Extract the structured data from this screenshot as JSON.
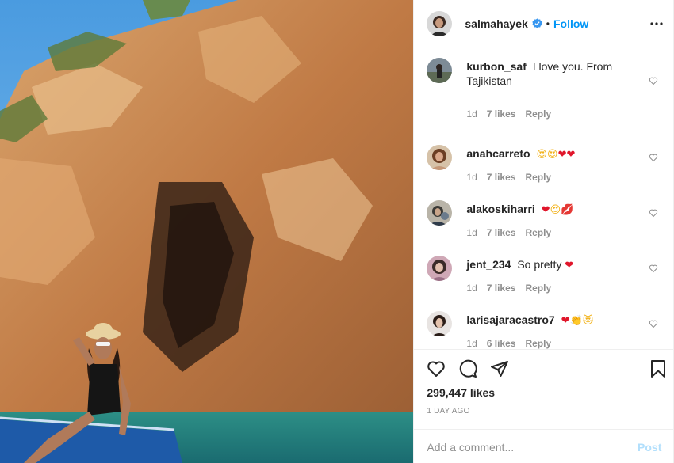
{
  "header": {
    "username": "salmahayek",
    "separator": "•",
    "follow_label": "Follow",
    "verified_icon": "verified-badge-icon",
    "more_icon": "more-options-icon"
  },
  "comments": [
    {
      "username": "kurbon_saf",
      "text": "I love you. From Tajikistan",
      "emoji": [],
      "time": "1d",
      "likes": "7 likes",
      "reply": "Reply"
    },
    {
      "username": "anahcarreto",
      "text": "",
      "emoji": [
        "😍",
        "😍",
        "❤",
        "❤"
      ],
      "time": "1d",
      "likes": "7 likes",
      "reply": "Reply"
    },
    {
      "username": "alakoskiharri",
      "text": "",
      "emoji": [
        "❤",
        "😍",
        "💋"
      ],
      "time": "1d",
      "likes": "7 likes",
      "reply": "Reply"
    },
    {
      "username": "jent_234",
      "text": "So pretty",
      "emoji": [
        "❤"
      ],
      "time": "1d",
      "likes": "7 likes",
      "reply": "Reply"
    },
    {
      "username": "larisajaracastro7",
      "text": "",
      "emoji": [
        "❤",
        "👏",
        "😻"
      ],
      "time": "1d",
      "likes": "6 likes",
      "reply": "Reply"
    }
  ],
  "actions": {
    "like_icon": "heart-icon",
    "comment_icon": "comment-icon",
    "share_icon": "share-icon",
    "save_icon": "bookmark-icon",
    "likes_count": "299,447 likes",
    "time_ago": "1 DAY AGO"
  },
  "composer": {
    "placeholder": "Add a comment...",
    "post_label": "Post"
  },
  "colors": {
    "link_blue": "#0095f6",
    "post_disabled": "#b2dffc",
    "meta_grey": "#8e8e8e",
    "heart_red": "#e0162b"
  }
}
